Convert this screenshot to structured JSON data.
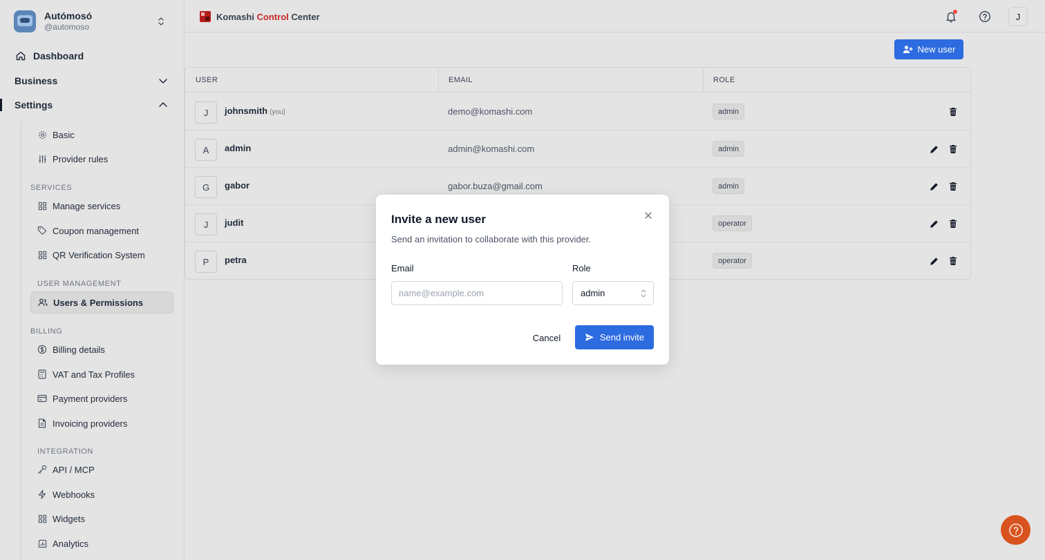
{
  "org": {
    "name": "Autómosó",
    "handle": "@automoso"
  },
  "nav": {
    "dashboard": "Dashboard",
    "business": "Business",
    "settings": "Settings",
    "items": {
      "basic": "Basic",
      "provider_rules": "Provider rules",
      "services_title": "SERVICES",
      "manage_services": "Manage services",
      "coupon_management": "Coupon management",
      "qr_verification": "QR Verification System",
      "user_management_title": "USER MANAGEMENT",
      "users_permissions": "Users & Permissions",
      "billing_title": "BILLING",
      "billing_details": "Billing details",
      "vat_tax": "VAT and Tax Profiles",
      "payment_providers": "Payment providers",
      "invoicing_providers": "Invoicing providers",
      "integration_title": "INTEGRATION",
      "api_mcp": "API / MCP",
      "webhooks": "Webhooks",
      "widgets": "Widgets",
      "analytics": "Analytics"
    }
  },
  "header": {
    "brand_part1": "Komashi",
    "brand_part2": "Control",
    "brand_part3": "Center",
    "user_initial": "J"
  },
  "toolbar": {
    "new_user_label": "New user"
  },
  "table": {
    "columns": {
      "user": "USER",
      "email": "EMAIL",
      "role": "ROLE"
    },
    "rows": [
      {
        "initial": "J",
        "name": "johnsmith",
        "you": "(you)",
        "email": "demo@komashi.com",
        "role": "admin"
      },
      {
        "initial": "A",
        "name": "admin",
        "you": "",
        "email": "admin@komashi.com",
        "role": "admin"
      },
      {
        "initial": "G",
        "name": "gabor",
        "you": "",
        "email": "gabor.buza@gmail.com",
        "role": "admin"
      },
      {
        "initial": "J",
        "name": "judit",
        "you": "",
        "email": "",
        "role": "operator"
      },
      {
        "initial": "P",
        "name": "petra",
        "you": "",
        "email": "",
        "role": "operator"
      }
    ]
  },
  "modal": {
    "title": "Invite a new user",
    "description": "Send an invitation to collaborate with this provider.",
    "email_label": "Email",
    "email_placeholder": "name@example.com",
    "email_value": "",
    "role_label": "Role",
    "role_value": "admin",
    "cancel_label": "Cancel",
    "send_label": "Send invite"
  },
  "colors": {
    "primary": "#2d6be0",
    "brand_accent": "#c62828",
    "help_fab": "#d9531e",
    "notification_dot": "#ef4444"
  },
  "icons": {
    "org_switch": "chevrons-up-down-icon",
    "dashboard": "home-icon",
    "notification": "bell-icon",
    "help": "help-circle-icon",
    "delete": "trash-icon",
    "edit": "pencil-icon",
    "send": "send-icon",
    "close": "close-icon"
  }
}
